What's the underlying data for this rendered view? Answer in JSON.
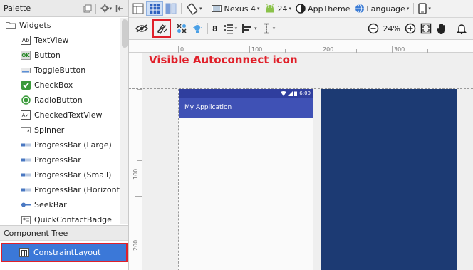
{
  "palette": {
    "title": "Palette",
    "group": "Widgets",
    "items": [
      {
        "label": "TextView",
        "icon": "textview-icon",
        "glyph": "Ab"
      },
      {
        "label": "Button",
        "icon": "button-icon",
        "glyph": "OK"
      },
      {
        "label": "ToggleButton",
        "icon": "togglebutton-icon",
        "glyph": ""
      },
      {
        "label": "CheckBox",
        "icon": "checkbox-icon",
        "glyph": "✔"
      },
      {
        "label": "RadioButton",
        "icon": "radiobutton-icon",
        "glyph": ""
      },
      {
        "label": "CheckedTextView",
        "icon": "checkedtextview-icon",
        "glyph": "A✓"
      },
      {
        "label": "Spinner",
        "icon": "spinner-icon",
        "glyph": ""
      },
      {
        "label": "ProgressBar (Large)",
        "icon": "progressbar-icon",
        "glyph": ""
      },
      {
        "label": "ProgressBar",
        "icon": "progressbar-icon",
        "glyph": ""
      },
      {
        "label": "ProgressBar (Small)",
        "icon": "progressbar-icon",
        "glyph": ""
      },
      {
        "label": "ProgressBar (Horizontal)",
        "icon": "progressbar-icon",
        "glyph": ""
      },
      {
        "label": "SeekBar",
        "icon": "seekbar-icon",
        "glyph": ""
      },
      {
        "label": "QuickContactBadge",
        "icon": "quickcontactbadge-icon",
        "glyph": ""
      }
    ]
  },
  "component_tree": {
    "title": "Component Tree",
    "root": "ConstraintLayout"
  },
  "toolbar": {
    "device": "Nexus 4",
    "api": "24",
    "theme": "AppTheme",
    "language": "Language",
    "margin": "8",
    "zoom": "24%"
  },
  "canvas": {
    "annotation": "Visible Autoconnect icon",
    "ruler_top": [
      "0",
      "100",
      "200",
      "300"
    ],
    "ruler_left": [
      "100",
      "200"
    ],
    "status_time": "6:00",
    "app_title": "My Application"
  },
  "colors": {
    "accent_red": "#e0202a",
    "selection_blue": "#3b78d8",
    "app_bar": "#3f51b5",
    "blueprint": "#1c3a73"
  }
}
